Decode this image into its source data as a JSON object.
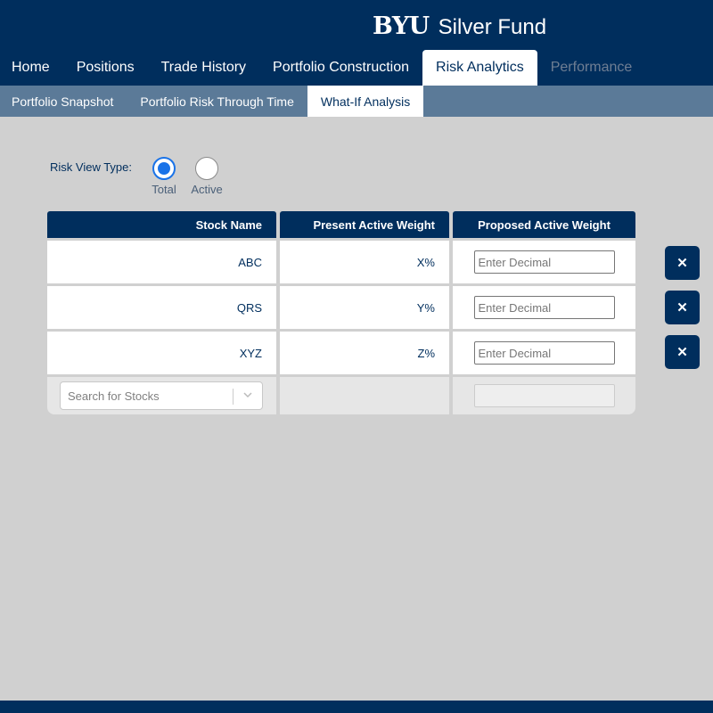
{
  "brand": {
    "logo": "BYU",
    "name": "Silver Fund"
  },
  "main_tabs": [
    {
      "label": "Home",
      "state": "normal"
    },
    {
      "label": "Positions",
      "state": "normal"
    },
    {
      "label": "Trade History",
      "state": "normal"
    },
    {
      "label": "Portfolio Construction",
      "state": "normal"
    },
    {
      "label": "Risk Analytics",
      "state": "active"
    },
    {
      "label": "Performance",
      "state": "disabled"
    }
  ],
  "sub_tabs": [
    {
      "label": "Portfolio Snapshot",
      "state": "normal"
    },
    {
      "label": "Portfolio Risk Through Time",
      "state": "normal"
    },
    {
      "label": "What-If Analysis",
      "state": "active"
    }
  ],
  "risk_view": {
    "label": "Risk View Type:",
    "options": [
      {
        "label": "Total",
        "selected": true
      },
      {
        "label": "Active",
        "selected": false
      }
    ]
  },
  "table": {
    "headers": [
      "Stock Name",
      "Present Active Weight",
      "Proposed Active Weight"
    ],
    "rows": [
      {
        "stock": "ABC",
        "present": "X%",
        "proposed_placeholder": "Enter Decimal"
      },
      {
        "stock": "QRS",
        "present": "Y%",
        "proposed_placeholder": "Enter Decimal"
      },
      {
        "stock": "XYZ",
        "present": "Z%",
        "proposed_placeholder": "Enter Decimal"
      }
    ],
    "search_placeholder": "Search for Stocks",
    "delete_label": "✕"
  },
  "colors": {
    "navy": "#002e5d",
    "subnav": "#5b7a98",
    "background": "#d0d0d0",
    "radio_selected": "#1a73e8"
  }
}
